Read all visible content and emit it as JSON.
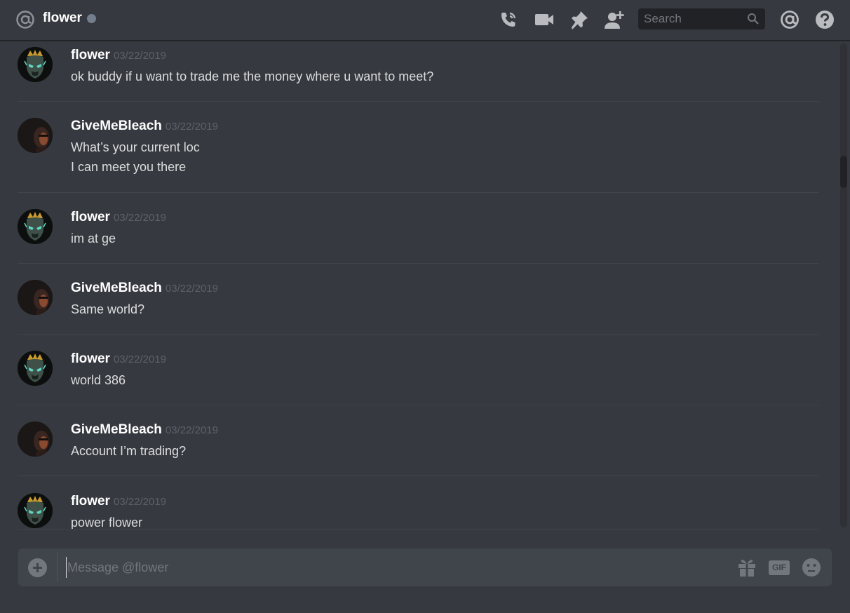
{
  "header": {
    "channel_icon": "at-sign-icon",
    "username": "flower",
    "status": "offline",
    "search": {
      "placeholder": "Search"
    },
    "icons": [
      "phone-call-icon",
      "video-call-icon",
      "pin-icon",
      "add-friend-icon",
      "search-icon",
      "mentions-icon",
      "help-icon"
    ]
  },
  "messages": [
    {
      "author": "flower",
      "timestamp": "03/22/2019",
      "avatar": "mask-avatar",
      "lines": [
        "ok buddy if u want to trade me the money where u want to meet?"
      ]
    },
    {
      "author": "GiveMeBleach",
      "timestamp": "03/22/2019",
      "avatar": "photo-avatar",
      "lines": [
        "What’s your current loc",
        "I can meet you there"
      ]
    },
    {
      "author": "flower",
      "timestamp": "03/22/2019",
      "avatar": "mask-avatar",
      "lines": [
        "im at ge"
      ]
    },
    {
      "author": "GiveMeBleach",
      "timestamp": "03/22/2019",
      "avatar": "photo-avatar",
      "lines": [
        "Same world?"
      ]
    },
    {
      "author": "flower",
      "timestamp": "03/22/2019",
      "avatar": "mask-avatar",
      "lines": [
        "world 386"
      ]
    },
    {
      "author": "GiveMeBleach",
      "timestamp": "03/22/2019",
      "avatar": "photo-avatar",
      "lines": [
        "Account I’m trading?"
      ]
    },
    {
      "author": "flower",
      "timestamp": "03/22/2019",
      "avatar": "mask-avatar",
      "lines": [
        "power flower"
      ]
    }
  ],
  "composer": {
    "placeholder": "Message @flower",
    "gif_label": "GIF",
    "icons": [
      "upload-plus-icon",
      "gift-icon",
      "gif-icon",
      "emoji-icon"
    ]
  },
  "colors": {
    "background": "#36393f",
    "header_border": "#202225",
    "text": "#dcddde",
    "username": "#ffffff",
    "timestamp": "#5d6168",
    "muted": "#72767d",
    "input_bg": "#40444b"
  }
}
